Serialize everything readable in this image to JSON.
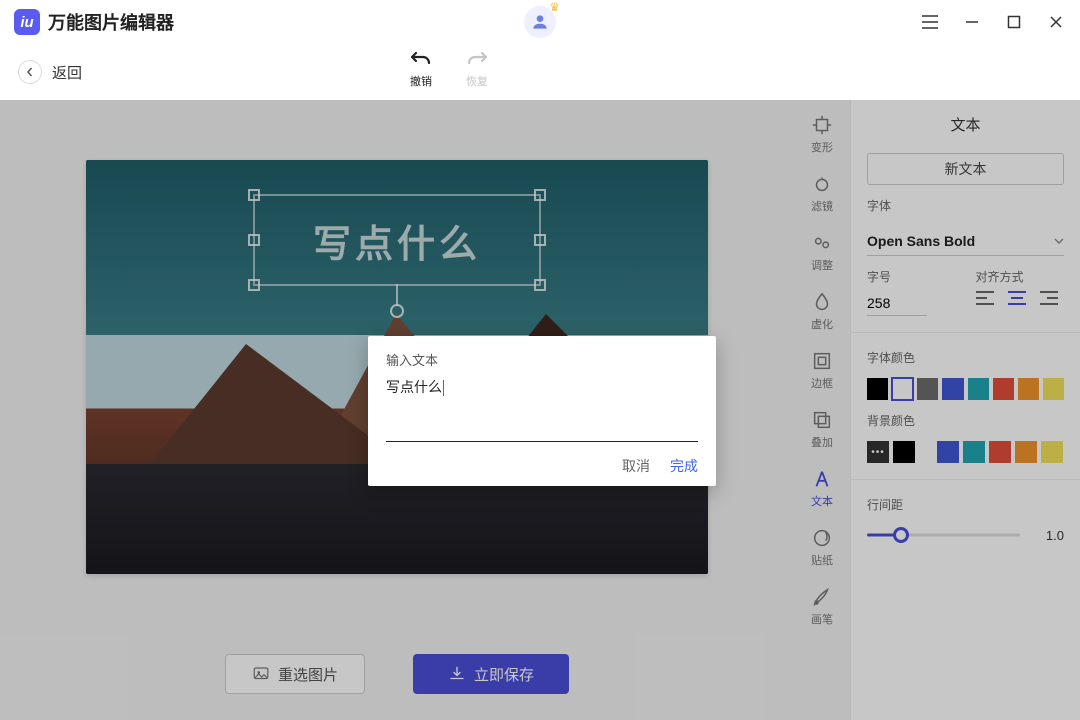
{
  "app": {
    "title": "万能图片编辑器",
    "logo_letter": "iu"
  },
  "titlebar": {
    "menu": "≡",
    "avatar_emoji": "👤"
  },
  "toolbar": {
    "back_label": "返回",
    "undo_label": "撤销",
    "redo_label": "恢复"
  },
  "canvas": {
    "text_placeholder": "写点什么"
  },
  "bottom": {
    "reselect": "重选图片",
    "save": "立即保存"
  },
  "tools": [
    {
      "id": "transform",
      "label": "变形"
    },
    {
      "id": "filter",
      "label": "滤镜"
    },
    {
      "id": "adjust",
      "label": "调整"
    },
    {
      "id": "blur",
      "label": "虚化"
    },
    {
      "id": "border",
      "label": "边框"
    },
    {
      "id": "overlay",
      "label": "叠加"
    },
    {
      "id": "text",
      "label": "文本",
      "active": true
    },
    {
      "id": "sticker",
      "label": "贴纸"
    },
    {
      "id": "brush",
      "label": "画笔"
    }
  ],
  "panel": {
    "title": "文本",
    "new_text": "新文本",
    "font_label": "字体",
    "font_value": "Open Sans Bold",
    "size_label": "字号",
    "size_value": "258",
    "align_label": "对齐方式",
    "align_value": "center",
    "font_color_label": "字体颜色",
    "font_colors": [
      "#000000",
      "#ffffff",
      "#6c6c6c",
      "#3f57d3",
      "#22a6b3",
      "#e14d3a",
      "#f0932b",
      "#f1e05a"
    ],
    "font_color_selected_index": 1,
    "bg_color_label": "背景颜色",
    "bg_colors_lead": "dots",
    "bg_colors": [
      "#000000",
      "#3f57d3",
      "#22a6b3",
      "#e14d3a",
      "#f0932b",
      "#f1e05a"
    ],
    "line_spacing_label": "行间距",
    "line_spacing_value": "1.0"
  },
  "dialog": {
    "title": "输入文本",
    "value": "写点什么",
    "cancel": "取消",
    "ok": "完成"
  }
}
